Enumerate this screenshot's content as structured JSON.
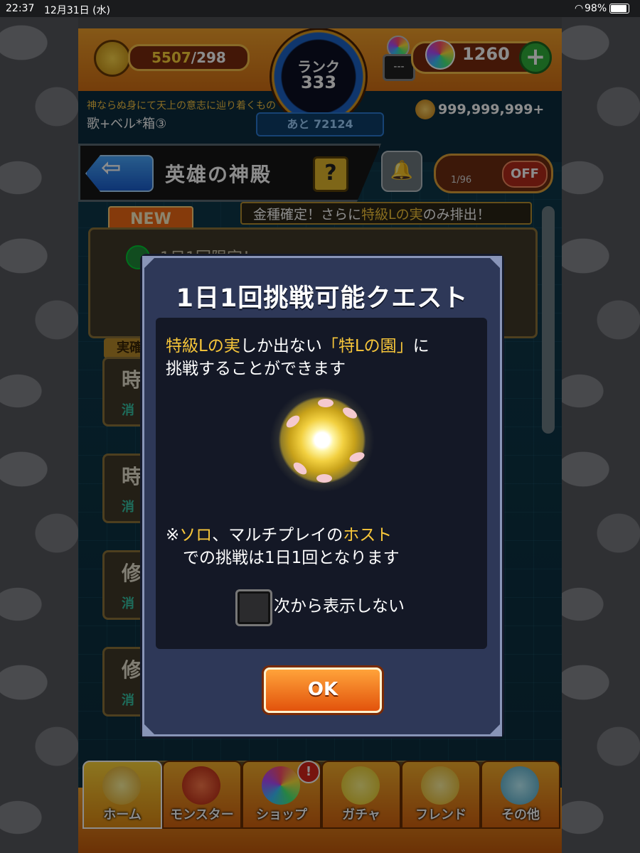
{
  "status_bar": {
    "time": "22:37",
    "date": "12月31日 (水)",
    "battery": "98%"
  },
  "header": {
    "stamina_current": "5507",
    "stamina_max": "/298",
    "rank_label": "ランク",
    "rank_value": "333",
    "exp_remaining": "あと 72124",
    "title": "神ならぬ身にて天上の意志に辿り着くもの",
    "player_name": "歌+ベル*箱③",
    "machine_label": "---",
    "orb_count": "1260",
    "plus_label": "+",
    "coins": "999,999,999+"
  },
  "titlebar": {
    "back_label": "⇦",
    "page_title": "英雄の神殿",
    "help_label": "?",
    "toggle_count": "1/96",
    "toggle_label": "OFF"
  },
  "background_list": {
    "new_tag": "NEW",
    "banner_prefix": "金種確定！さらに",
    "banner_highlight": "特級Lの実",
    "banner_suffix": "のみ排出！",
    "first_card_text": "1日1回限定！",
    "cards": [
      {
        "char": "時",
        "sub": "消"
      },
      {
        "char": "時",
        "sub": "消"
      },
      {
        "char": "修",
        "sub": "消"
      },
      {
        "char": "修",
        "sub": "消"
      }
    ],
    "side_tag": "実確"
  },
  "dialog": {
    "title": "1日1回挑戦可能クエスト",
    "line1_a": "特級Lの実",
    "line1_b": "しか出ない",
    "line1_c": "「特Lの園」",
    "line1_d": "に",
    "line2": "挑戦することができます",
    "note1_a": "※",
    "note1_b": "ソロ",
    "note1_c": "、マルチプレイの",
    "note1_d": "ホスト",
    "note2": "での挑戦は1日1回となります",
    "checkbox_label": "次から表示しない",
    "ok_label": "OK"
  },
  "bottom_nav": [
    {
      "label": "ホーム",
      "icon": "home-gate-icon"
    },
    {
      "label": "モンスター",
      "icon": "monster-icon"
    },
    {
      "label": "ショップ",
      "icon": "orb-icon",
      "badge": "!"
    },
    {
      "label": "ガチャ",
      "icon": "gacha-egg-icon"
    },
    {
      "label": "フレンド",
      "icon": "friends-icon"
    },
    {
      "label": "その他",
      "icon": "other-icon"
    }
  ],
  "colors": {
    "accent_orange": "#f2a12b",
    "highlight_yellow": "#f7c63a",
    "dialog_bg": "#2e3858",
    "ok_button": "#e2530c"
  }
}
